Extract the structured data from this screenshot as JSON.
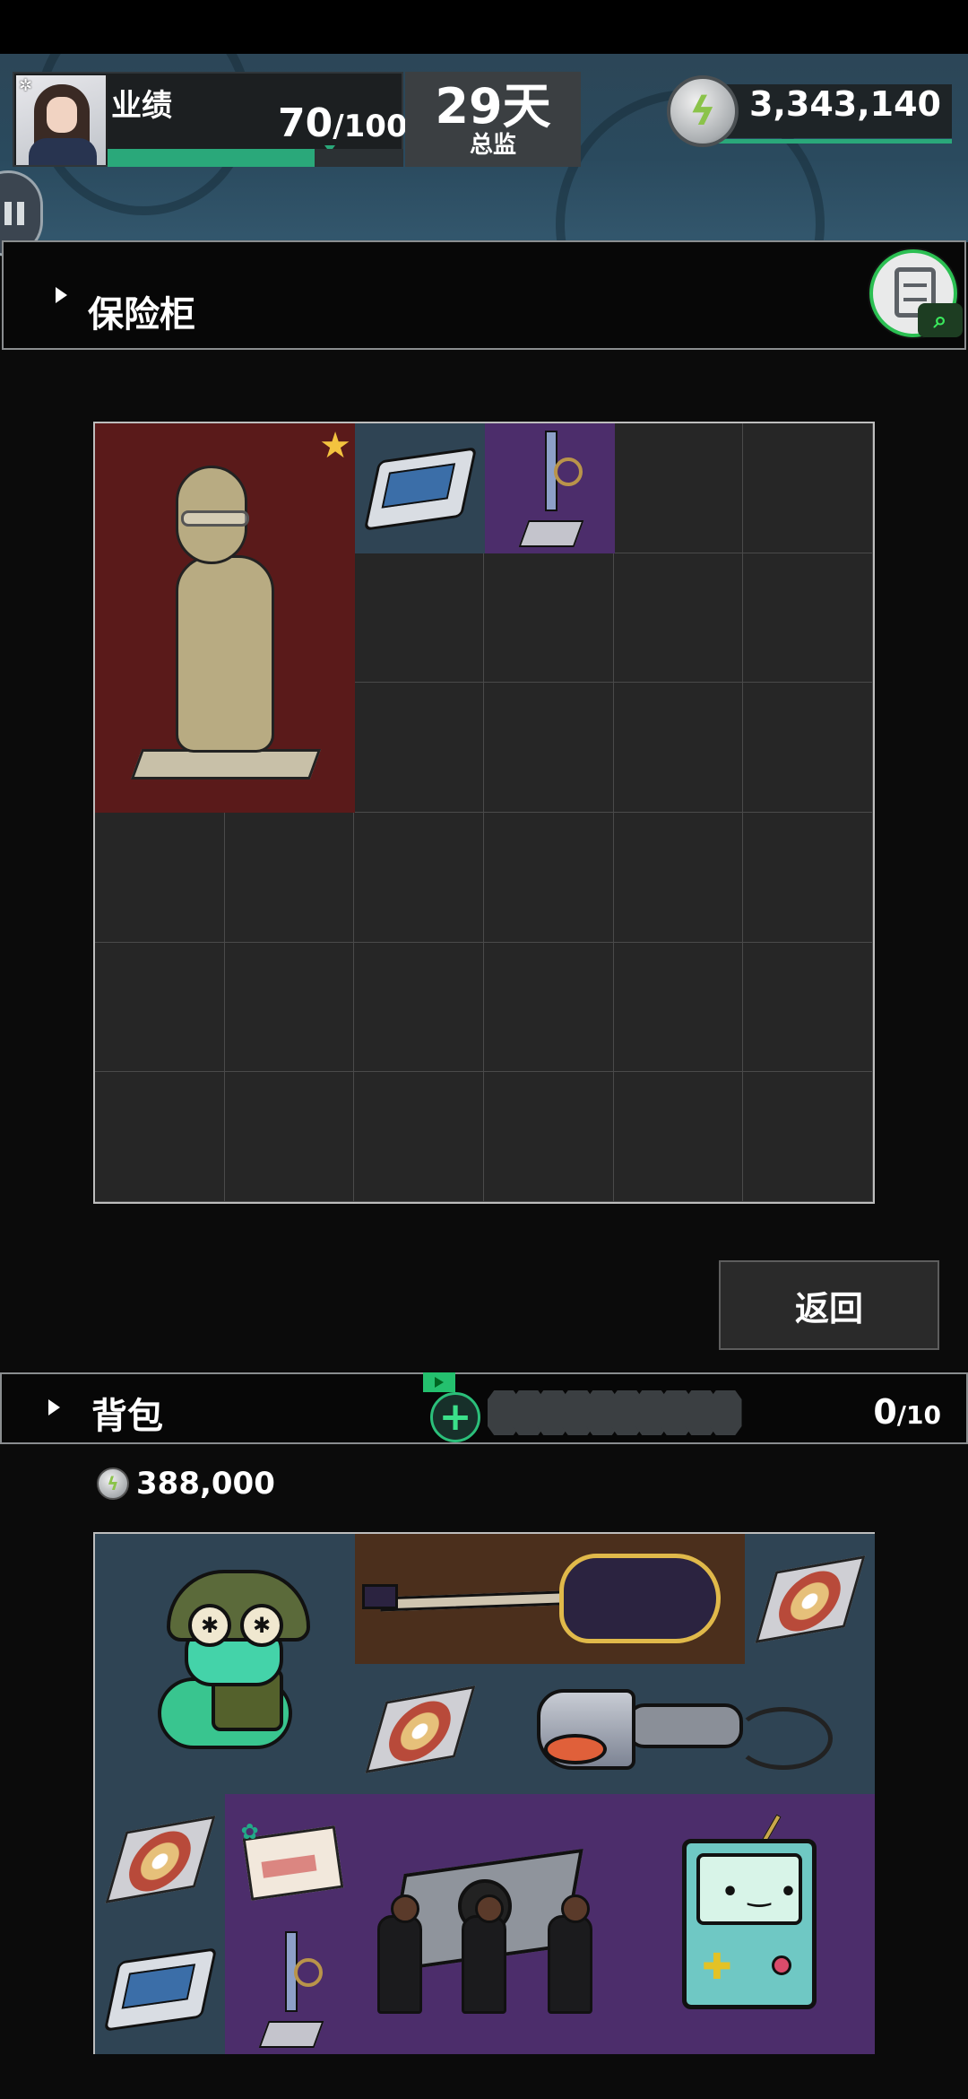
{
  "header": {
    "performance_label": "业绩",
    "performance_value": "70",
    "performance_max": "/100",
    "performance_progress": 0.7,
    "days_value": "29天",
    "rank_title": "总监",
    "coins": "3,343,140"
  },
  "safe": {
    "title": "保险柜",
    "columns": 6,
    "rows": 6
  },
  "return_button": "返回",
  "backpack": {
    "title": "背包",
    "add_icon": "plus-icon",
    "slot_count": 10,
    "capacity_used": "0",
    "capacity_max": "/10",
    "money": "388,000",
    "columns": 6,
    "rows": 4
  },
  "colors": {
    "accent_green": "#2aa87a",
    "rarity_red": "#5a1a1a",
    "rarity_blue": "#2f4454",
    "rarity_purple": "#4c2d6b",
    "rarity_brown": "#4b2f1c",
    "star": "#f3c33f"
  },
  "safe_items": [
    {
      "name": "statue-item",
      "icon": "alpaca-statue-icon",
      "rarity": "red",
      "starred": true
    },
    {
      "name": "floppy-disk-item",
      "icon": "floppy-disk-icon",
      "rarity": "blue"
    },
    {
      "name": "trophy-item",
      "icon": "sword-trophy-icon",
      "rarity": "purple"
    }
  ],
  "backpack_items": [
    {
      "name": "frog-item",
      "icon": "frog-soldier-icon",
      "rarity": "blue"
    },
    {
      "name": "guitar-item",
      "icon": "electric-guitar-icon",
      "rarity": "brown"
    },
    {
      "name": "cd-item-1",
      "icon": "cd-disc-icon",
      "rarity": "blue"
    },
    {
      "name": "cd-item-2",
      "icon": "cd-disc-icon",
      "rarity": "blue"
    },
    {
      "name": "hair-dryer-item",
      "icon": "hair-dryer-icon",
      "rarity": "blue"
    },
    {
      "name": "cd-item-3",
      "icon": "cd-disc-icon",
      "rarity": "blue"
    },
    {
      "name": "ticket-item",
      "icon": "travel-ticket-icon",
      "rarity": "purple"
    },
    {
      "name": "coffin-dance-item",
      "icon": "coffin-dance-icon",
      "rarity": "purple"
    },
    {
      "name": "bmo-item",
      "icon": "bmo-robot-icon",
      "rarity": "purple"
    },
    {
      "name": "floppy-disk-item-2",
      "icon": "floppy-disk-icon",
      "rarity": "blue"
    },
    {
      "name": "trophy-item-2",
      "icon": "sword-trophy-icon",
      "rarity": "purple"
    }
  ]
}
